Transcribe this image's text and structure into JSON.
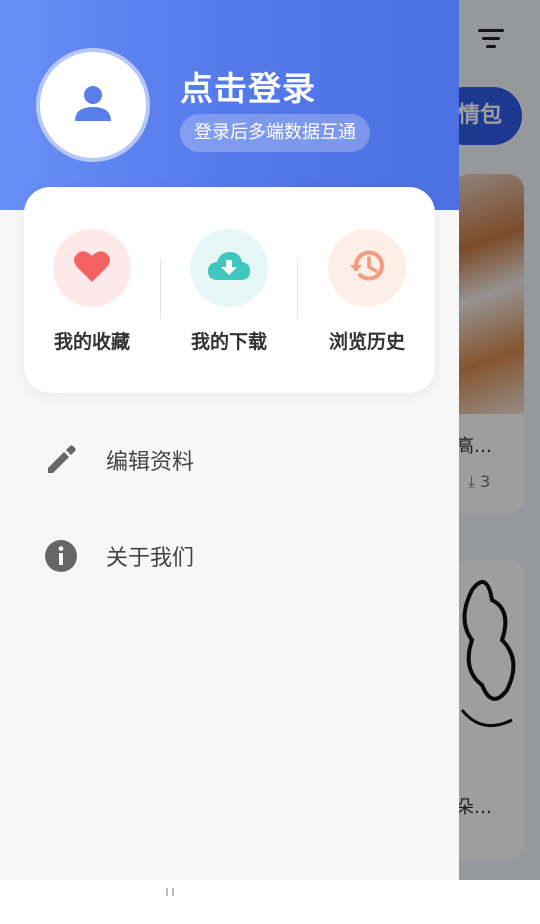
{
  "drawer": {
    "user": {
      "login_title": "点击登录",
      "login_subtitle": "登录后多端数据互通",
      "avatar_icon": "person-icon"
    },
    "quick_actions": [
      {
        "label": "我的收藏",
        "icon": "heart-icon",
        "color": "#f56262"
      },
      {
        "label": "我的下载",
        "icon": "cloud-download-icon",
        "color": "#3fc7bd"
      },
      {
        "label": "浏览历史",
        "icon": "history-icon",
        "color": "#f39b7d"
      }
    ],
    "menu": [
      {
        "label": "编辑资料",
        "icon": "edit-pencil-icon"
      },
      {
        "label": "关于我们",
        "icon": "info-icon"
      }
    ]
  },
  "background": {
    "tab_label": "情包",
    "filter_icon": "filter-icon",
    "cards": [
      {
        "title": "高…",
        "download_count": "3"
      },
      {
        "title": "朵…"
      }
    ]
  },
  "colors": {
    "header_gradient_start": "#6a8ff7",
    "header_gradient_end": "#4c70e2",
    "accent_blue": "#2f5be7"
  }
}
